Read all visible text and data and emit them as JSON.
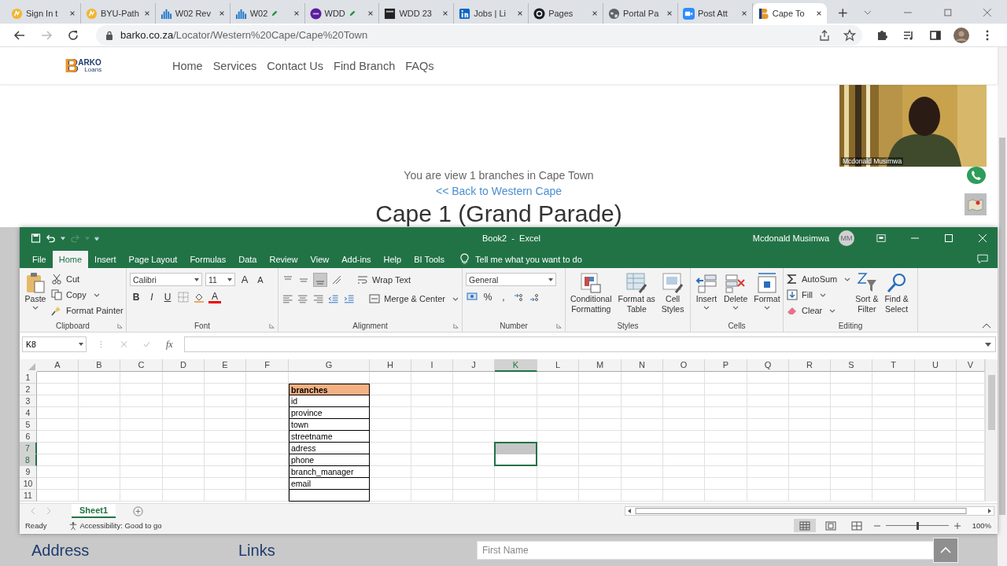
{
  "browser": {
    "tabs": [
      {
        "title": "Sign In t",
        "pencil": false,
        "selected": false
      },
      {
        "title": "BYU-Path",
        "pencil": false,
        "selected": false
      },
      {
        "title": "W02 Rev",
        "pencil": false,
        "selected": false
      },
      {
        "title": "W02",
        "pencil": true,
        "selected": false
      },
      {
        "title": "WDD",
        "pencil": true,
        "selected": false
      },
      {
        "title": "WDD 23",
        "pencil": false,
        "selected": false
      },
      {
        "title": "Jobs | Li",
        "pencil": false,
        "selected": false
      },
      {
        "title": "Pages",
        "pencil": false,
        "selected": false
      },
      {
        "title": "Portal Pa",
        "pencil": false,
        "selected": false
      },
      {
        "title": "Post Att",
        "pencil": false,
        "selected": false
      },
      {
        "title": "Cape To",
        "pencil": false,
        "selected": true
      }
    ],
    "url_host": "barko.co.za",
    "url_path": "/Locator/Western%20Cape/Cape%20Town"
  },
  "site": {
    "logo": {
      "initial": "B",
      "name": "ARKO",
      "tagline": "Loans"
    },
    "nav": [
      "Home",
      "Services",
      "Contact Us",
      "Find Branch",
      "FAQs"
    ],
    "summary": "You are view 1 branches in Cape Town",
    "back_link": "<< Back to Western Cape",
    "heading": "Cape 1 (Grand Parade)",
    "video": {
      "caption": "Mcdonald Musimwa"
    },
    "footer": {
      "columns": [
        "Address",
        "Links"
      ],
      "first_name_placeholder": "First Name"
    }
  },
  "excel": {
    "title": "Book2  -  Excel",
    "user": "Mcdonald Musimwa",
    "initials": "MM",
    "ribbon_tabs": [
      {
        "label": "File",
        "selected": false
      },
      {
        "label": "Home",
        "selected": true
      },
      {
        "label": "Insert",
        "selected": false
      },
      {
        "label": "Page Layout",
        "selected": false
      },
      {
        "label": "Formulas",
        "selected": false
      },
      {
        "label": "Data",
        "selected": false
      },
      {
        "label": "Review",
        "selected": false
      },
      {
        "label": "View",
        "selected": false
      },
      {
        "label": "Add-ins",
        "selected": false
      },
      {
        "label": "Help",
        "selected": false
      },
      {
        "label": "BI Tools",
        "selected": false
      }
    ],
    "tell_me": "Tell me what you want to do",
    "clipboard": {
      "paste": "Paste",
      "cut": "Cut",
      "copy": "Copy",
      "format_painter": "Format Painter",
      "label": "Clipboard"
    },
    "font": {
      "name": "Calibri",
      "size": "11",
      "size_buttons": [
        "A",
        "A"
      ],
      "styles": [
        "B",
        "I",
        "U"
      ],
      "color_letter": "A",
      "label": "Font"
    },
    "alignment": {
      "wrap": "Wrap Text",
      "merge": "Merge & Center",
      "label": "Alignment"
    },
    "number": {
      "format": "General",
      "symbols": [
        "%",
        ","
      ],
      "label": "Number"
    },
    "styles": {
      "buttons": [
        {
          "lines": [
            "Conditional",
            "Formatting"
          ]
        },
        {
          "lines": [
            "Format as",
            "Table"
          ]
        },
        {
          "lines": [
            "Cell",
            "Styles"
          ]
        }
      ],
      "label": "Styles"
    },
    "cells_group": {
      "buttons": [
        "Insert",
        "Delete",
        "Format"
      ],
      "label": "Cells"
    },
    "editing": {
      "items": [
        "AutoSum",
        "Fill",
        "Clear"
      ],
      "buttons": [
        {
          "lines": [
            "Sort &",
            "Filter"
          ]
        },
        {
          "lines": [
            "Find &",
            "Select"
          ]
        }
      ],
      "label": "Editing"
    },
    "name_box": "K8",
    "fx": "fx",
    "columns": [
      {
        "label": "A",
        "selected": false
      },
      {
        "label": "B",
        "selected": false
      },
      {
        "label": "C",
        "selected": false
      },
      {
        "label": "D",
        "selected": false
      },
      {
        "label": "E",
        "selected": false
      },
      {
        "label": "F",
        "selected": false
      },
      {
        "label": "G",
        "selected": false
      },
      {
        "label": "H",
        "selected": false
      },
      {
        "label": "I",
        "selected": false
      },
      {
        "label": "J",
        "selected": false
      },
      {
        "label": "K",
        "selected": true
      },
      {
        "label": "L",
        "selected": false
      },
      {
        "label": "M",
        "selected": false
      },
      {
        "label": "N",
        "selected": false
      },
      {
        "label": "O",
        "selected": false
      },
      {
        "label": "P",
        "selected": false
      },
      {
        "label": "Q",
        "selected": false
      },
      {
        "label": "R",
        "selected": false
      },
      {
        "label": "S",
        "selected": false
      },
      {
        "label": "T",
        "selected": false
      },
      {
        "label": "U",
        "selected": false
      },
      {
        "label": "V",
        "selected": false
      }
    ],
    "rows": [
      {
        "label": "1",
        "selected": false
      },
      {
        "label": "2",
        "selected": false,
        "G": {
          "text": "branches",
          "kind": "header"
        }
      },
      {
        "label": "3",
        "selected": false,
        "G": {
          "text": "id",
          "kind": "field"
        }
      },
      {
        "label": "4",
        "selected": false,
        "G": {
          "text": "province",
          "kind": "field"
        }
      },
      {
        "label": "5",
        "selected": false,
        "G": {
          "text": "town",
          "kind": "field"
        }
      },
      {
        "label": "6",
        "selected": false,
        "G": {
          "text": "streetname",
          "kind": "field"
        }
      },
      {
        "label": "7",
        "selected": true,
        "G": {
          "text": "adress",
          "kind": "field"
        },
        "K": {
          "kind": "shaded"
        }
      },
      {
        "label": "8",
        "selected": true,
        "G": {
          "text": "phone",
          "kind": "field"
        }
      },
      {
        "label": "9",
        "selected": false,
        "G": {
          "text": "branch_manager",
          "kind": "field"
        }
      },
      {
        "label": "10",
        "selected": false,
        "G": {
          "text": "email",
          "kind": "field"
        }
      },
      {
        "label": "11",
        "selected": false,
        "G": {
          "kind": "field"
        }
      }
    ],
    "sheets": [
      {
        "label": "Sheet1",
        "selected": true
      }
    ],
    "status": "Ready",
    "accessibility": "Accessibility: Good to go",
    "views": [
      {
        "kind": "normal",
        "selected": true
      },
      {
        "kind": "page_layout",
        "selected": false
      },
      {
        "kind": "page_break",
        "selected": false
      }
    ],
    "zoom": {
      "level": 0.5,
      "reading": "100%"
    }
  }
}
